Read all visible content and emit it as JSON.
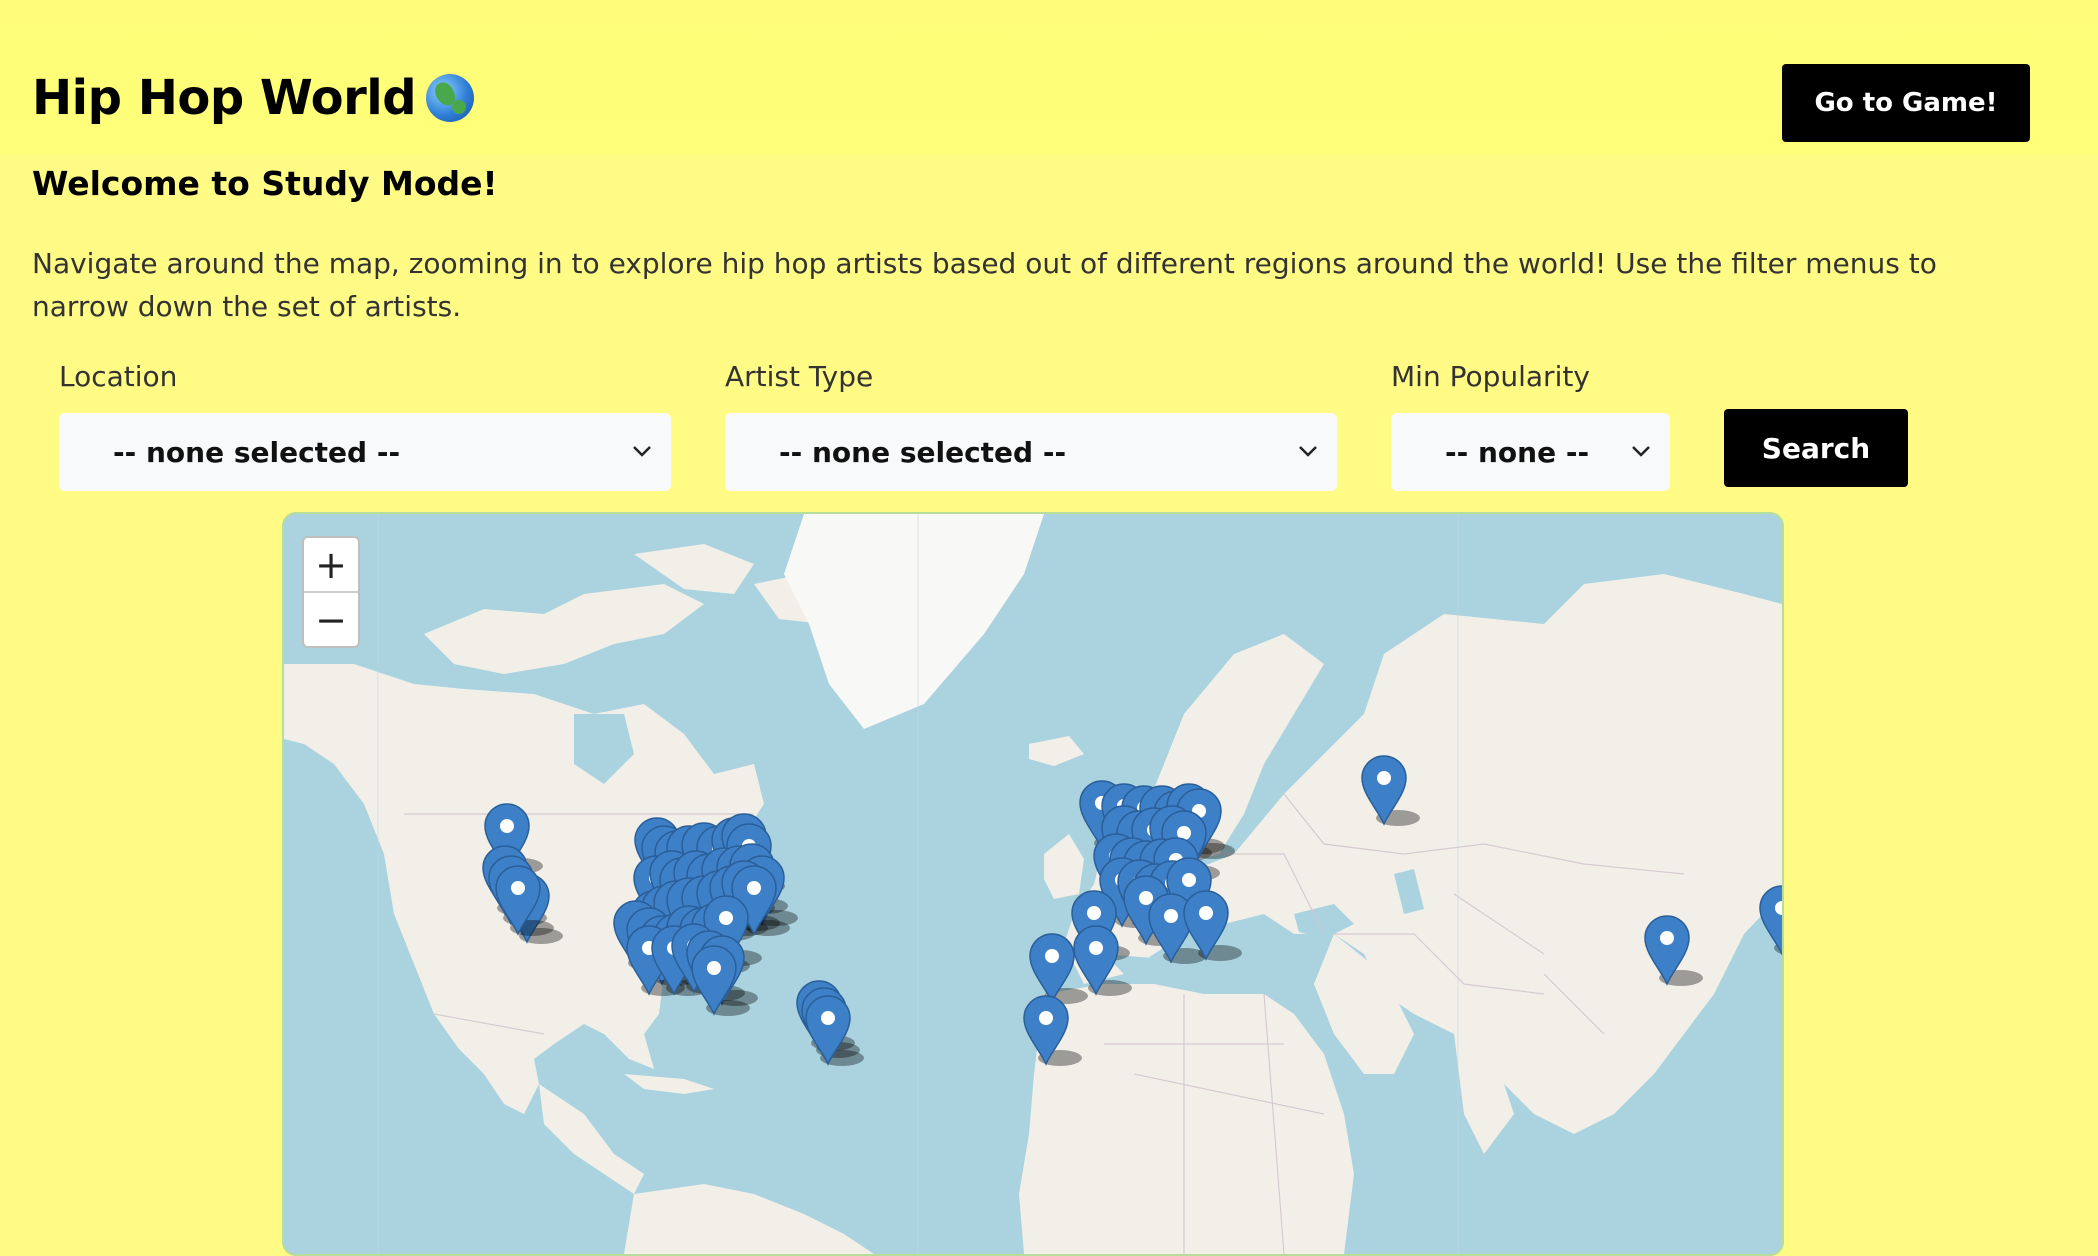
{
  "header": {
    "title": "Hip Hop World",
    "globe_icon": "earth-globe-emoji",
    "game_button": "Go to Game!"
  },
  "welcome": {
    "heading": "Welcome to Study Mode!",
    "description": "Navigate around the map, zooming in to explore hip hop artists based out of different regions around the world! Use the filter menus to narrow down the set of artists."
  },
  "filters": {
    "location": {
      "label": "Location",
      "selected": "-- none selected --"
    },
    "artist_type": {
      "label": "Artist Type",
      "selected": "-- none selected --"
    },
    "min_popularity": {
      "label": "Min Popularity",
      "selected": "-- none --"
    },
    "search_button": "Search"
  },
  "map": {
    "zoom_in": "+",
    "zoom_out": "−",
    "marker_icon": "map-pin-marker-icon",
    "colors": {
      "water": "#aad3df",
      "land": "#f2efe9",
      "ice": "#f8f8f6",
      "marker": "#3d80c8"
    }
  }
}
